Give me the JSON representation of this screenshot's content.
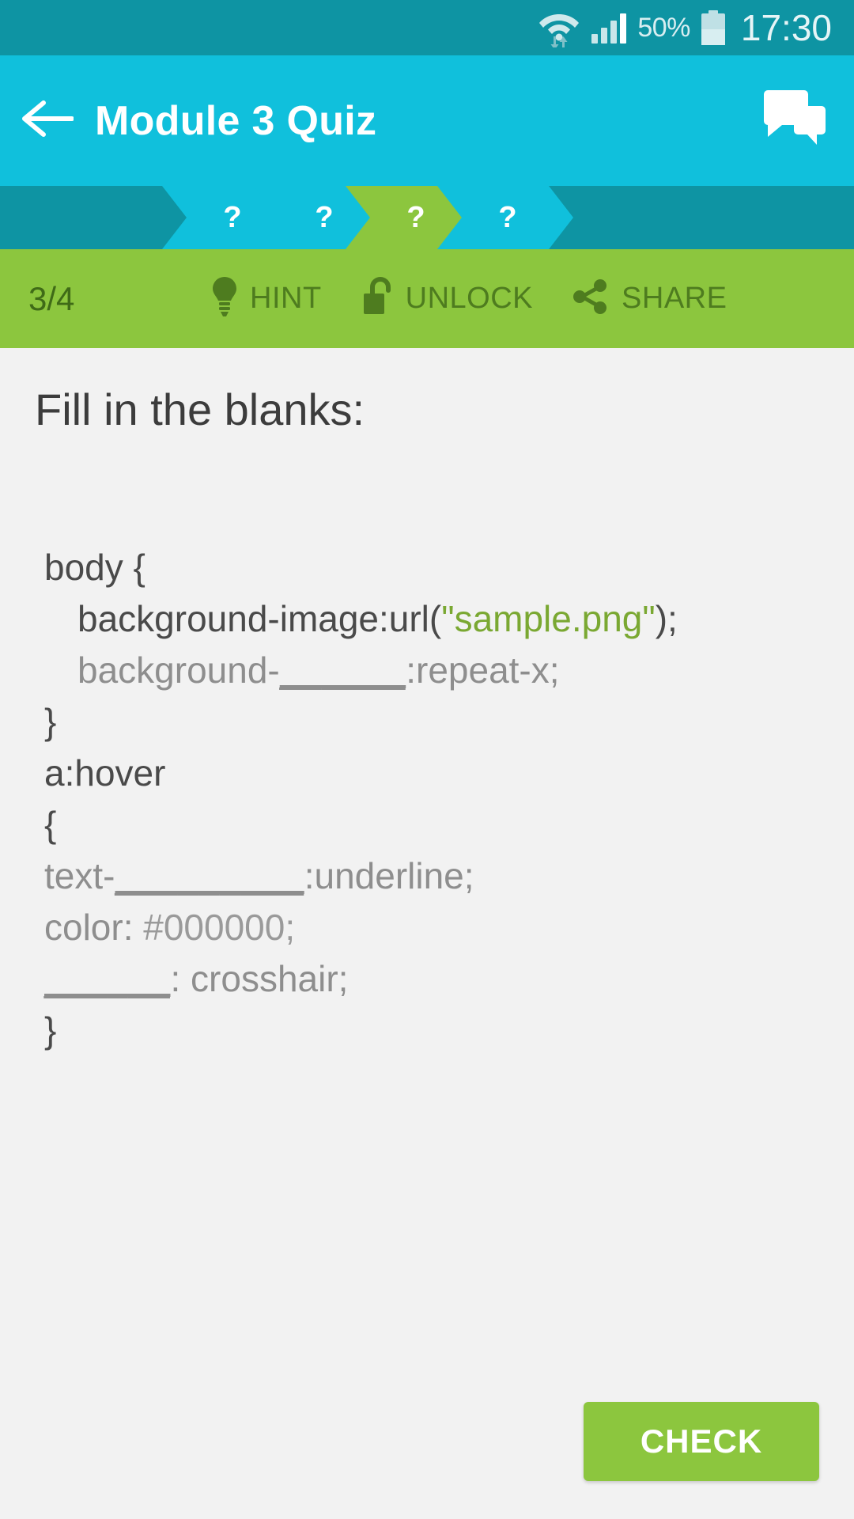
{
  "statusbar": {
    "wifi_icon": "wifi-icon",
    "signal_icon": "signal-bars-icon",
    "battery_percent": "50%",
    "battery_icon": "battery-icon",
    "time": "17:30"
  },
  "appbar": {
    "back_icon": "back-arrow-icon",
    "title": "Module 3 Quiz",
    "chat_icon": "chat-bubbles-icon"
  },
  "progress": {
    "steps": [
      {
        "label": "?",
        "state": "pending"
      },
      {
        "label": "?",
        "state": "pending"
      },
      {
        "label": "?",
        "state": "current"
      },
      {
        "label": "?",
        "state": "pending"
      }
    ],
    "colors": {
      "track": "#0e94a3",
      "pending": "#10c0dc",
      "current": "#8cc63e"
    }
  },
  "actionbar": {
    "counter": "3/4",
    "hint_label": "HINT",
    "hint_icon": "lightbulb-icon",
    "unlock_label": "UNLOCK",
    "unlock_icon": "open-padlock-icon",
    "share_label": "SHARE",
    "share_icon": "share-nodes-icon",
    "background_color": "#8cc63e"
  },
  "question": {
    "prompt": "Fill in the blanks:",
    "code_lines": [
      {
        "indent": 0,
        "dim": false,
        "parts": [
          {
            "text": "body {",
            "style": "plain"
          }
        ]
      },
      {
        "indent": 1,
        "dim": false,
        "parts": [
          {
            "text": "background-image:url(",
            "style": "plain"
          },
          {
            "text": "\"sample.png\"",
            "style": "green"
          },
          {
            "text": ");",
            "style": "plain"
          }
        ]
      },
      {
        "indent": 1,
        "dim": true,
        "parts": [
          {
            "text": "background-",
            "style": "plain"
          },
          {
            "text": "______",
            "style": "blank"
          },
          {
            "text": ":repeat-x;",
            "style": "plain"
          }
        ]
      },
      {
        "indent": 0,
        "dim": false,
        "parts": [
          {
            "text": "}",
            "style": "plain"
          }
        ]
      },
      {
        "indent": 0,
        "dim": false,
        "parts": [
          {
            "text": "a:hover",
            "style": "plain"
          }
        ]
      },
      {
        "indent": 0,
        "dim": false,
        "parts": [
          {
            "text": "{",
            "style": "plain"
          }
        ]
      },
      {
        "indent": 0,
        "dim": true,
        "parts": [
          {
            "text": "text-",
            "style": "plain"
          },
          {
            "text": "_________",
            "style": "blank"
          },
          {
            "text": ":underline;",
            "style": "plain"
          }
        ]
      },
      {
        "indent": 0,
        "dim": true,
        "parts": [
          {
            "text": "color: ",
            "style": "plain"
          },
          {
            "text": "#000000;",
            "style": "dimvalue"
          }
        ]
      },
      {
        "indent": 0,
        "dim": true,
        "parts": [
          {
            "text": "______",
            "style": "blank"
          },
          {
            "text": ": crosshair;",
            "style": "plain"
          }
        ]
      },
      {
        "indent": 0,
        "dim": false,
        "parts": [
          {
            "text": "}",
            "style": "plain"
          }
        ]
      }
    ]
  },
  "footer": {
    "check_label": "CHECK"
  }
}
